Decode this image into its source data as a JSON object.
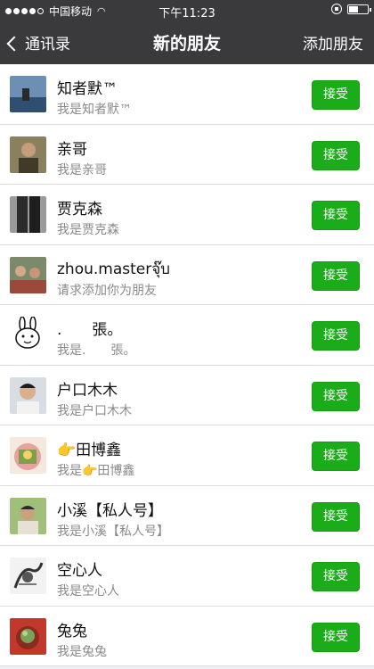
{
  "status_bar": {
    "carrier": "中国移动",
    "time": "下午11:23",
    "battery_level": 0.55
  },
  "nav": {
    "back_label": "通讯录",
    "title": "新的朋友",
    "add_label": "添加朋友"
  },
  "requests": [
    {
      "name": "知者默™",
      "message": "我是知者默™",
      "button": "接受"
    },
    {
      "name": "亲哥",
      "message": "我是亲哥",
      "button": "接受"
    },
    {
      "name": "贾克森",
      "message": "我是贾克森",
      "button": "接受"
    },
    {
      "name": "zhou.masterจุ๊บ",
      "message": "请求添加你为朋友",
      "button": "接受"
    },
    {
      "name": ".　　張。",
      "message": "我是.　　張。",
      "button": "接受"
    },
    {
      "name": "户口木木",
      "message": "我是户口木木",
      "button": "接受"
    },
    {
      "name": "👉田博鑫",
      "message": "我是👉田博鑫",
      "button": "接受"
    },
    {
      "name": "小溪【私人号】",
      "message": "我是小溪【私人号】",
      "button": "接受"
    },
    {
      "name": "空心人",
      "message": "我是空心人",
      "button": "接受"
    },
    {
      "name": "兔兔",
      "message": "我是兔兔",
      "button": "接受"
    }
  ],
  "colors": {
    "header_bg": "#3a3a3d",
    "accept_green": "#1aad19",
    "page_bg": "#efeff4"
  }
}
